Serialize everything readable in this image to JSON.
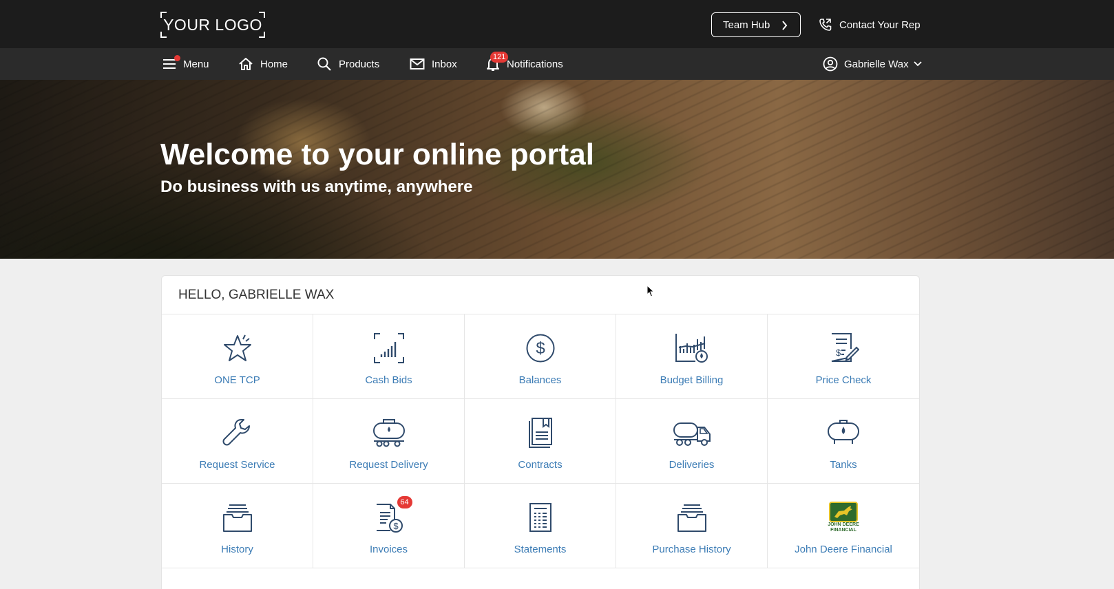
{
  "header": {
    "logo": "YOUR LOGO",
    "team_hub": "Team Hub",
    "contact": "Contact Your Rep"
  },
  "nav": {
    "menu": "Menu",
    "home": "Home",
    "products": "Products",
    "inbox": "Inbox",
    "notifications": "Notifications",
    "notifications_count": "121",
    "user": "Gabrielle Wax"
  },
  "hero": {
    "title": "Welcome to your online portal",
    "subtitle": "Do business with us anytime, anywhere"
  },
  "dashboard": {
    "greeting": "HELLO, GABRIELLE WAX",
    "tiles": [
      {
        "label": "ONE TCP",
        "icon": "star-icon"
      },
      {
        "label": "Cash Bids",
        "icon": "bar-chart-icon"
      },
      {
        "label": "Balances",
        "icon": "dollar-circle-icon"
      },
      {
        "label": "Budget Billing",
        "icon": "budget-billing-icon"
      },
      {
        "label": "Price Check",
        "icon": "price-check-icon"
      },
      {
        "label": "Request Service",
        "icon": "wrench-icon"
      },
      {
        "label": "Request Delivery",
        "icon": "tank-trailer-icon"
      },
      {
        "label": "Contracts",
        "icon": "document-icon"
      },
      {
        "label": "Deliveries",
        "icon": "truck-icon"
      },
      {
        "label": "Tanks",
        "icon": "tank-icon"
      },
      {
        "label": "History",
        "icon": "file-box-icon"
      },
      {
        "label": "Invoices",
        "icon": "invoice-icon",
        "badge": "64"
      },
      {
        "label": "Statements",
        "icon": "statement-icon"
      },
      {
        "label": "Purchase History",
        "icon": "file-box-icon"
      },
      {
        "label": "John Deere Financial",
        "icon": "john-deere-logo",
        "logo_text": "JOHN DEERE FINANCIAL"
      }
    ]
  },
  "colors": {
    "topbar": "#1c1c1c",
    "navbar": "#2b2b2b",
    "link": "#3c7cb5",
    "icon": "#2f4a6b",
    "badge": "#e53935"
  }
}
